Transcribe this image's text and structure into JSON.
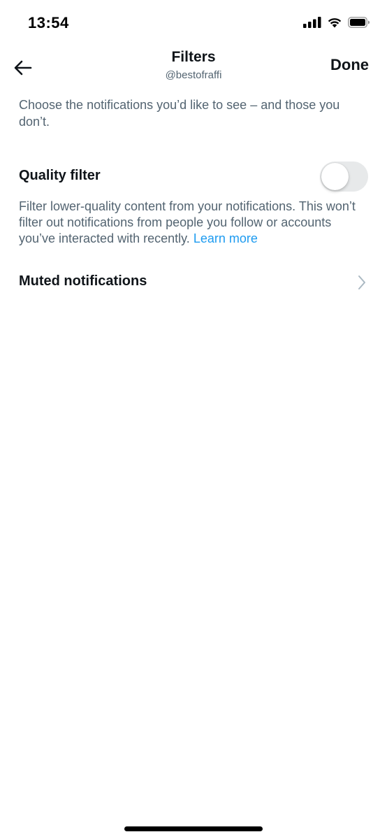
{
  "status_bar": {
    "time": "13:54",
    "icons": [
      "cellular-signal-icon",
      "wifi-icon",
      "battery-icon"
    ]
  },
  "nav": {
    "back_icon": "back-arrow-icon",
    "title": "Filters",
    "subtitle": "@bestofraffi",
    "done_label": "Done"
  },
  "intro_text": "Choose the notifications you’d like to see – and those you don’t.",
  "quality_filter": {
    "label": "Quality filter",
    "enabled": false,
    "description": "Filter lower-quality content from your notifications. This won’t filter out notifications from people you follow or accounts you’ve interacted with recently.",
    "learn_more_label": "Learn more"
  },
  "muted_notifications": {
    "label": "Muted notifications",
    "icon": "chevron-right-icon"
  },
  "colors": {
    "primary_text": "#0f1419",
    "secondary_text": "#536471",
    "link": "#1d9bf0",
    "toggle_off_track": "#e7e9ea"
  }
}
